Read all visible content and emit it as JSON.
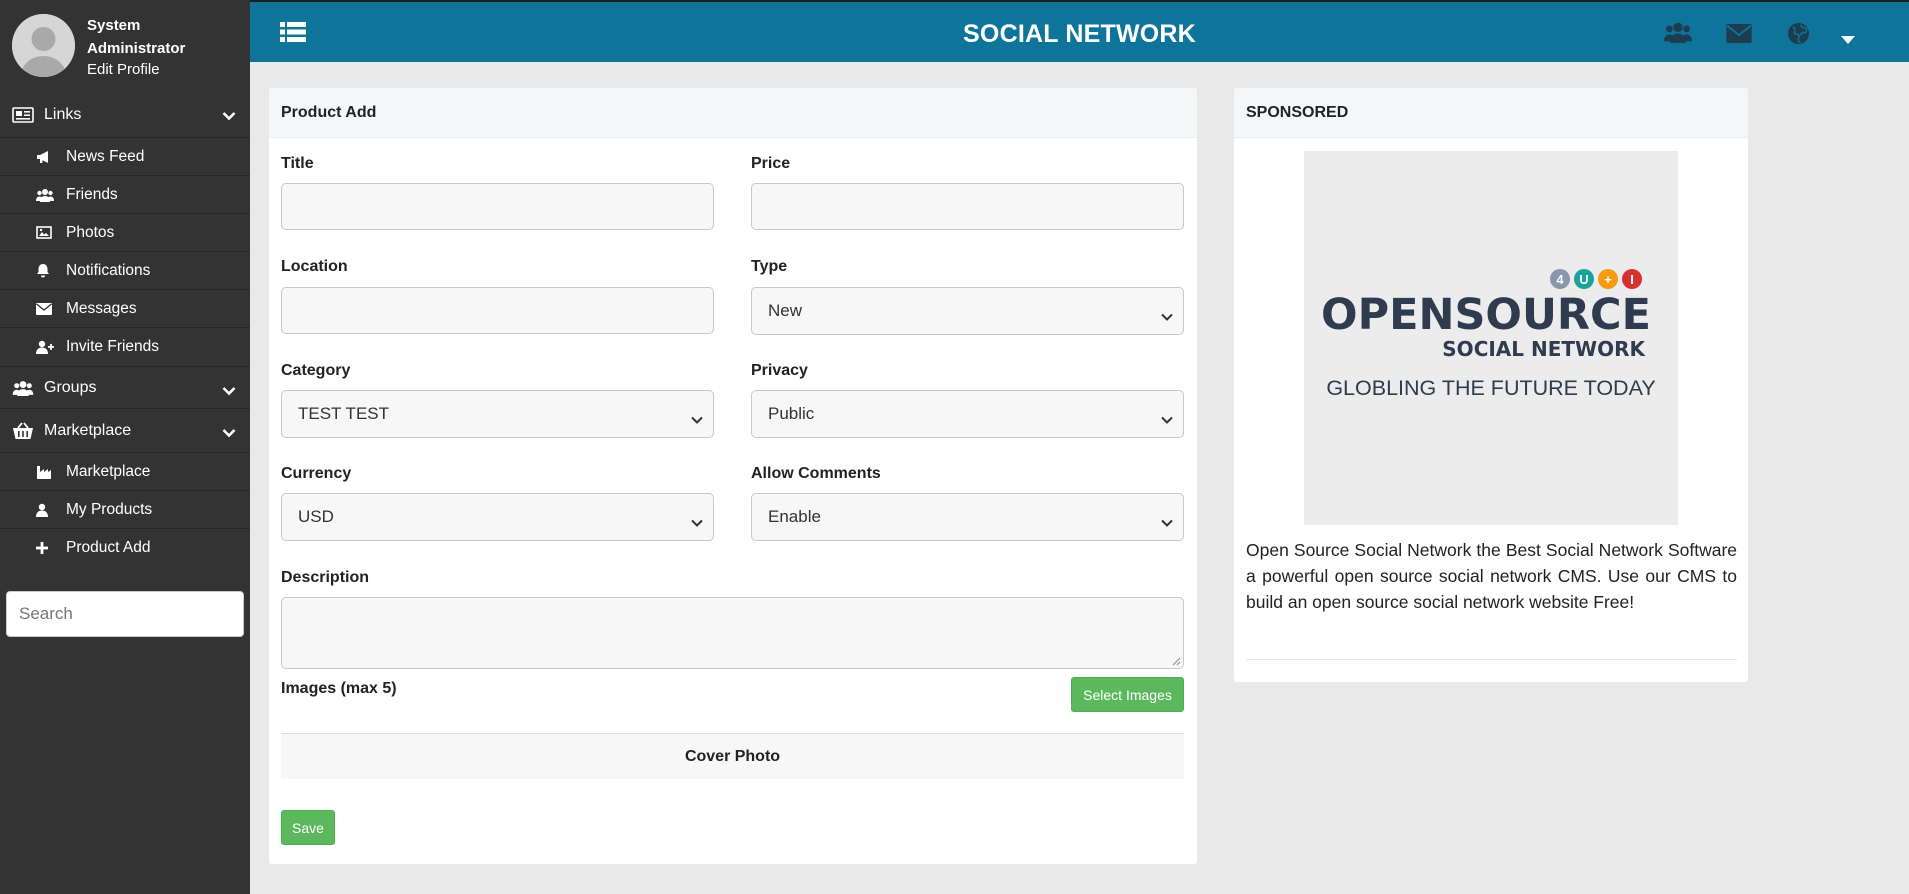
{
  "sidebar": {
    "profile": {
      "name": "System Administrator",
      "edit_label": "Edit Profile"
    },
    "links": {
      "label": "Links",
      "items": [
        {
          "label": "News Feed",
          "icon": "bullhorn-icon"
        },
        {
          "label": "Friends",
          "icon": "users-icon"
        },
        {
          "label": "Photos",
          "icon": "image-icon"
        },
        {
          "label": "Notifications",
          "icon": "bell-icon"
        },
        {
          "label": "Messages",
          "icon": "envelope-icon"
        },
        {
          "label": "Invite Friends",
          "icon": "user-plus-icon"
        }
      ]
    },
    "groups": {
      "label": "Groups"
    },
    "marketplace": {
      "label": "Marketplace",
      "items": [
        {
          "label": "Marketplace",
          "icon": "industry-icon"
        },
        {
          "label": "My Products",
          "icon": "user-icon"
        },
        {
          "label": "Product Add",
          "icon": "plus-icon"
        }
      ]
    },
    "search": {
      "placeholder": "Search"
    }
  },
  "topbar": {
    "title": "SOCIAL NETWORK",
    "accent": "#0e7499"
  },
  "product_form": {
    "heading": "Product Add",
    "title_label": "Title",
    "price_label": "Price",
    "location_label": "Location",
    "type_label": "Type",
    "type_value": "New",
    "category_label": "Category",
    "category_value": "TEST TEST",
    "privacy_label": "Privacy",
    "privacy_value": "Public",
    "currency_label": "Currency",
    "currency_value": "USD",
    "comments_label": "Allow Comments",
    "comments_value": "Enable",
    "description_label": "Description",
    "images_label": "Images (max 5)",
    "select_images_label": "Select Images",
    "cover_photo_label": "Cover Photo",
    "save_label": "Save",
    "button_color": "#5cb85c"
  },
  "sponsored": {
    "heading": "SPONSORED",
    "logo_badge": "4U+I",
    "logo_main": "OPENSOURCE",
    "logo_sub": "SOCIAL NETWORK",
    "logo_tagline": "GLOBLING THE FUTURE TODAY",
    "text": "Open Source Social Network the Best Social Network Software a powerful open source social network CMS. Use our CMS to build an open source social network website Free!"
  }
}
